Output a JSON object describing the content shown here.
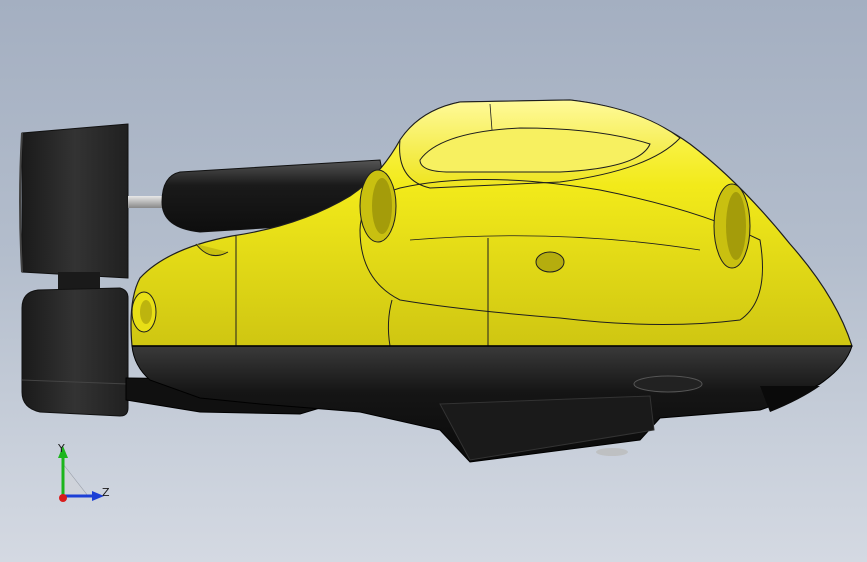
{
  "viewport": {
    "background_top": "#a4afc1",
    "background_bottom": "#d4d9e2"
  },
  "model": {
    "body_color": "#f2ea1a",
    "body_shadow_color": "#c9c010",
    "skirt_color": "#121212",
    "edge_color": "#1e1e1e",
    "thruster_color": "#2a2a2a"
  },
  "triad": {
    "y_label": "Y",
    "z_label": "Z",
    "y_color": "#1cb51c",
    "z_color": "#1c3fd6",
    "x_color": "#d81c1c"
  }
}
